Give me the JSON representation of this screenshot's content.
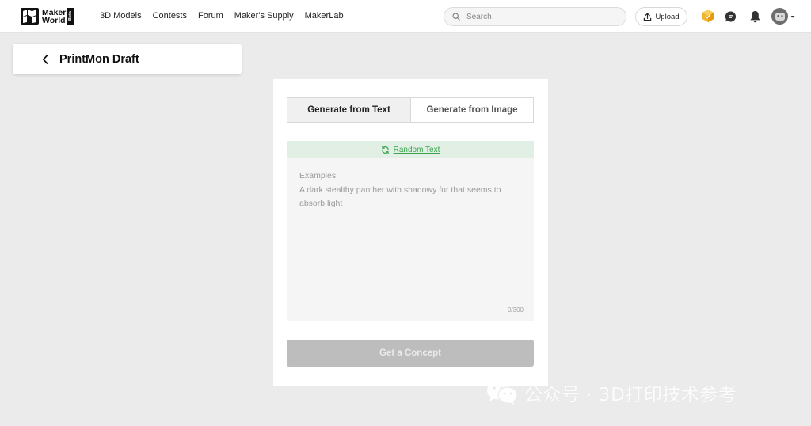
{
  "header": {
    "logo": {
      "line1": "Maker",
      "line2": "World",
      "badge": "Beta"
    },
    "nav": [
      {
        "label": "3D Models"
      },
      {
        "label": "Contests"
      },
      {
        "label": "Forum"
      },
      {
        "label": "Maker's Supply"
      },
      {
        "label": "MakerLab"
      }
    ],
    "search": {
      "placeholder": "Search",
      "value": ""
    },
    "upload_label": "Upload",
    "icons": [
      "search-icon",
      "upload-icon",
      "box-points-icon",
      "message-icon",
      "bell-icon",
      "avatar",
      "chevron-down-icon"
    ],
    "accent_color": "#f2b32d"
  },
  "page": {
    "title": "PrintMon Draft"
  },
  "generator": {
    "tabs": [
      {
        "label": "Generate from Text",
        "active": true
      },
      {
        "label": "Generate from Image",
        "active": false
      }
    ],
    "random_text_label": "Random Text",
    "prompt": {
      "value": "",
      "placeholder": "Examples:\nA dark stealthy panther with shadowy fur that seems to absorb light",
      "counter": "0/300"
    },
    "submit_label": "Get a Concept",
    "colors": {
      "random_bar_bg": "#e2efe4",
      "random_text": "#3aa54f",
      "button_disabled": "#bdbdbd"
    }
  },
  "watermark": {
    "text": "公众号 · 3D打印技术参考"
  }
}
